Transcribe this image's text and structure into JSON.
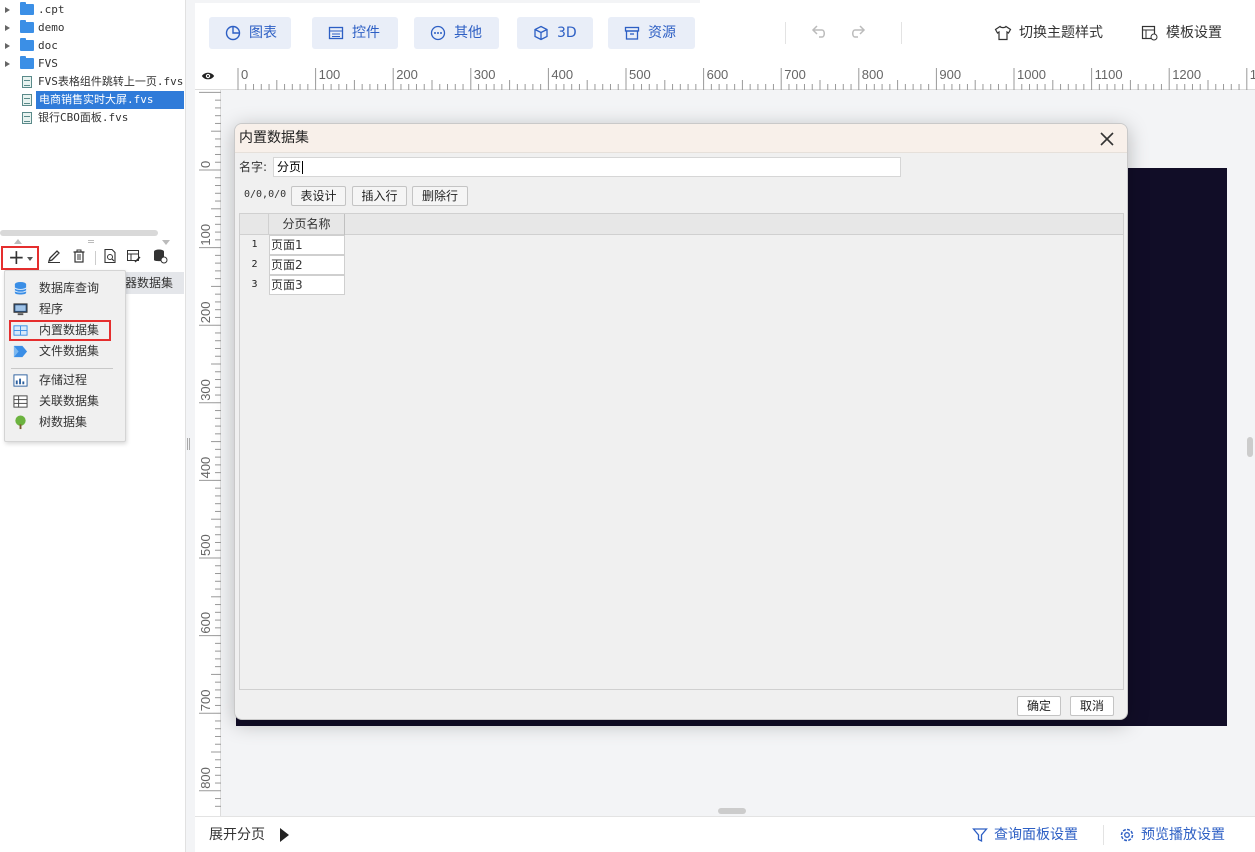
{
  "file_tree": {
    "items": [
      {
        "type": "folder",
        "label": ".cpt",
        "expandable": true
      },
      {
        "type": "folder",
        "label": "demo",
        "expandable": true
      },
      {
        "type": "folder",
        "label": "doc",
        "expandable": true
      },
      {
        "type": "folder",
        "label": "FVS",
        "expandable": true
      },
      {
        "type": "file",
        "label": "FVS表格组件跳转上一页.fvs"
      },
      {
        "type": "file",
        "label": "电商销售实时大屏.fvs",
        "selected": true
      },
      {
        "type": "file",
        "label": "银行CBO面板.fvs"
      }
    ]
  },
  "dataset_panel": {
    "tab_label": "器数据集",
    "add_menu": {
      "items": [
        {
          "label": "数据库查询",
          "icon": "database-icon"
        },
        {
          "label": "程序",
          "icon": "monitor-icon"
        },
        {
          "label": "内置数据集",
          "icon": "builtin-dataset-icon",
          "highlighted": true
        },
        {
          "label": "文件数据集",
          "icon": "file-dataset-icon"
        },
        {
          "label": "存储过程",
          "icon": "stored-procedure-icon"
        },
        {
          "label": "关联数据集",
          "icon": "related-dataset-icon"
        },
        {
          "label": "树数据集",
          "icon": "tree-icon"
        }
      ]
    }
  },
  "toolbar": {
    "buttons": [
      {
        "label": "图表",
        "icon": "chart-icon"
      },
      {
        "label": "控件",
        "icon": "widget-icon"
      },
      {
        "label": "其他",
        "icon": "more-icon"
      },
      {
        "label": "3D",
        "icon": "cube-icon"
      },
      {
        "label": "资源",
        "icon": "archive-icon"
      }
    ],
    "theme_label": "切换主题样式",
    "template_label": "模板设置"
  },
  "ruler": {
    "top_ticks": [
      "0",
      "100",
      "200",
      "300",
      "400",
      "500",
      "600",
      "700",
      "800",
      "900",
      "1000",
      "1100",
      "1200",
      "1"
    ],
    "left_ticks": [
      "0",
      "100",
      "200",
      "300",
      "400",
      "500",
      "600",
      "700",
      "800"
    ]
  },
  "dialog": {
    "title": "内置数据集",
    "name_label": "名字:",
    "name_value": "分页",
    "position_text": "0/0,0/0",
    "buttons": {
      "design": "表设计",
      "insert_row": "插入行",
      "delete_row": "删除行"
    },
    "table": {
      "columns": [
        "分页名称"
      ],
      "rows": [
        {
          "index": "1",
          "value": "页面1"
        },
        {
          "index": "2",
          "value": "页面2"
        },
        {
          "index": "3",
          "value": "页面3"
        }
      ]
    },
    "ok_label": "确定",
    "cancel_label": "取消"
  },
  "bottom_bar": {
    "expand_pages_label": "展开分页",
    "query_panel_label": "查询面板设置",
    "preview_label": "预览播放设置"
  },
  "colors": {
    "accent": "#2d5fc4",
    "toolbar_button_bg": "#e9eef8",
    "canvas_dark": "#110d27",
    "highlight_red": "#e52e2e",
    "selection_blue": "#2f7bd9"
  }
}
